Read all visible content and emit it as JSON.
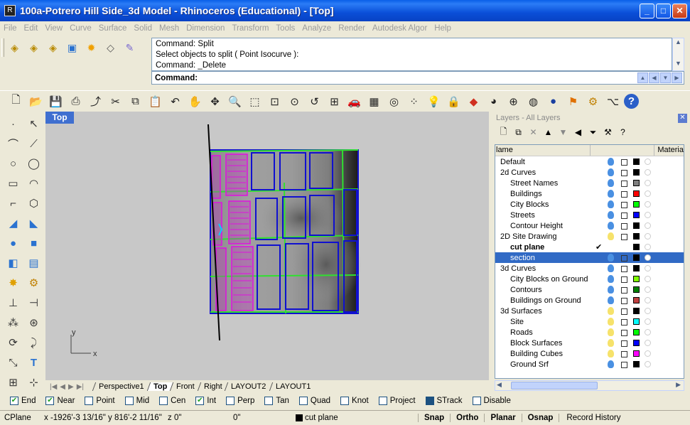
{
  "window": {
    "title": "100a-Potrero Hill Side_3d Model - Rhinoceros (Educational) - [Top]",
    "minimize": "_",
    "maximize": "□",
    "close": "✕"
  },
  "menu": [
    "File",
    "Edit",
    "View",
    "Curve",
    "Surface",
    "Solid",
    "Mesh",
    "Dimension",
    "Transform",
    "Tools",
    "Analyze",
    "Render",
    "Autodesk Algor",
    "Help"
  ],
  "command": {
    "history": [
      "Command: Split",
      "Select objects to split ( Point  Isocurve ):",
      "Command: _Delete"
    ],
    "prompt_label": "Command:",
    "prompt_value": ""
  },
  "viewport": {
    "title": "Top",
    "axis_y": "y",
    "axis_x": "x"
  },
  "view_tabs": {
    "items": [
      {
        "label": "Perspective1",
        "active": false
      },
      {
        "label": "Top",
        "active": true
      },
      {
        "label": "Front",
        "active": false
      },
      {
        "label": "Right",
        "active": false
      },
      {
        "label": "LAYOUT2",
        "active": false
      },
      {
        "label": "LAYOUT1",
        "active": false
      }
    ]
  },
  "layers": {
    "title": "Layers - All Layers",
    "col_name": "lame",
    "col_material": "Materia",
    "rows": [
      {
        "name": "Default",
        "indent": 0,
        "color": "#000000",
        "bulb": "on",
        "cur": false,
        "selected": false
      },
      {
        "name": "2d Curves",
        "indent": 0,
        "color": "#000000",
        "bulb": "on",
        "cur": false,
        "selected": false
      },
      {
        "name": "Street Names",
        "indent": 1,
        "color": "#808080",
        "bulb": "on",
        "cur": false,
        "selected": false
      },
      {
        "name": "Buildings",
        "indent": 1,
        "color": "#ff0000",
        "bulb": "on",
        "cur": false,
        "selected": false
      },
      {
        "name": "City Blocks",
        "indent": 1,
        "color": "#00ff00",
        "bulb": "on",
        "cur": false,
        "selected": false
      },
      {
        "name": "Streets",
        "indent": 1,
        "color": "#0000ff",
        "bulb": "on",
        "cur": false,
        "selected": false
      },
      {
        "name": "Contour Height",
        "indent": 1,
        "color": "#000000",
        "bulb": "on",
        "cur": false,
        "selected": false
      },
      {
        "name": "2D Site Drawing",
        "indent": 0,
        "color": "#000000",
        "bulb": "off",
        "cur": false,
        "selected": false
      },
      {
        "name": "cut plane",
        "indent": 1,
        "color": "#000000",
        "bulb": "none",
        "cur": true,
        "selected": false
      },
      {
        "name": "section",
        "indent": 1,
        "color": "#000000",
        "bulb": "on",
        "cur": false,
        "selected": true
      },
      {
        "name": "3d Curves",
        "indent": 0,
        "color": "#000000",
        "bulb": "on",
        "cur": false,
        "selected": false
      },
      {
        "name": "City Blocks on Ground",
        "indent": 1,
        "color": "#80ff00",
        "bulb": "on",
        "cur": false,
        "selected": false
      },
      {
        "name": "Contours",
        "indent": 1,
        "color": "#008000",
        "bulb": "on",
        "cur": false,
        "selected": false
      },
      {
        "name": "Buildings on Ground",
        "indent": 1,
        "color": "#c04040",
        "bulb": "on",
        "cur": false,
        "selected": false
      },
      {
        "name": "3d Surfaces",
        "indent": 0,
        "color": "#000000",
        "bulb": "off",
        "cur": false,
        "selected": false
      },
      {
        "name": "Site",
        "indent": 1,
        "color": "#00ffff",
        "bulb": "off",
        "cur": false,
        "selected": false
      },
      {
        "name": "Roads",
        "indent": 1,
        "color": "#00ff00",
        "bulb": "off",
        "cur": false,
        "selected": false
      },
      {
        "name": "Block Surfaces",
        "indent": 1,
        "color": "#0000ff",
        "bulb": "off",
        "cur": false,
        "selected": false
      },
      {
        "name": "Building Cubes",
        "indent": 1,
        "color": "#ff00ff",
        "bulb": "off",
        "cur": false,
        "selected": false
      },
      {
        "name": "Ground Srf",
        "indent": 1,
        "color": "#000000",
        "bulb": "on",
        "cur": false,
        "selected": false
      }
    ]
  },
  "osnaps": [
    {
      "label": "End",
      "checked": true
    },
    {
      "label": "Near",
      "checked": true
    },
    {
      "label": "Point",
      "checked": false
    },
    {
      "label": "Mid",
      "checked": false
    },
    {
      "label": "Cen",
      "checked": false
    },
    {
      "label": "Int",
      "checked": true
    },
    {
      "label": "Perp",
      "checked": false
    },
    {
      "label": "Tan",
      "checked": false
    },
    {
      "label": "Quad",
      "checked": false
    },
    {
      "label": "Knot",
      "checked": false
    },
    {
      "label": "Project",
      "checked": false
    },
    {
      "label": "STrack",
      "checked": true,
      "filled": true
    },
    {
      "label": "Disable",
      "checked": false
    }
  ],
  "status": {
    "cplane": "CPlane",
    "coords": "x -1926'-3 13/16\" y 816'-2 11/16\"",
    "z": "z 0\"",
    "dist": "0\"",
    "layer": "cut plane",
    "snap": "Snap",
    "ortho": "Ortho",
    "planar": "Planar",
    "osnap": "Osnap",
    "history": "Record History"
  }
}
